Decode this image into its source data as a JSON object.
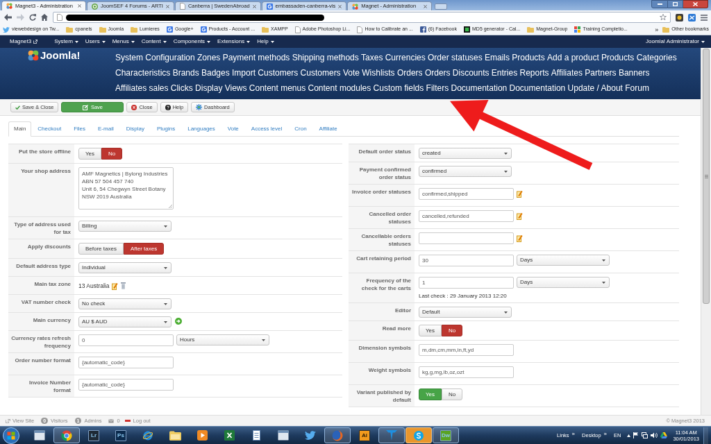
{
  "browser": {
    "tabs": [
      {
        "title": "Magnet3 - Administration",
        "kind": "joomla",
        "selected": true
      },
      {
        "title": "JoomSEF 4 Forums - ARTI",
        "kind": "joomsef",
        "selected": false
      },
      {
        "title": "Canberra | SwedenAbroad",
        "kind": "page",
        "selected": false
      },
      {
        "title": "embassaden-canberra-vis",
        "kind": "google",
        "selected": false
      },
      {
        "title": "Magnet - Administration",
        "kind": "joomla",
        "selected": false
      }
    ],
    "forward": {
      "disabled": true
    },
    "bookmarks": [
      {
        "label": "viewebdesign on Tw...",
        "kind": "twitter"
      },
      {
        "label": "cpanels",
        "kind": "folder"
      },
      {
        "label": "Joomla",
        "kind": "folder"
      },
      {
        "label": "Lumieres",
        "kind": "folder"
      },
      {
        "label": "Google+",
        "kind": "google"
      },
      {
        "label": "Products - Account ...",
        "kind": "google"
      },
      {
        "label": "XAMPP",
        "kind": "folder"
      },
      {
        "label": "Adobe Photoshop Li...",
        "kind": "page"
      },
      {
        "label": "How to Calibrate an ...",
        "kind": "page"
      },
      {
        "label": "(6) Facebook",
        "kind": "facebook"
      },
      {
        "label": "MD5 generator - Cal...",
        "kind": "md5"
      },
      {
        "label": "Magnet-Group",
        "kind": "folder"
      },
      {
        "label": "Training Completio...",
        "kind": "training"
      }
    ],
    "bookmarks_overflow": "»",
    "other_bookmarks": "Other bookmarks"
  },
  "admin_menu": {
    "site": "Magnet3",
    "items": [
      "System",
      "Users",
      "Menus",
      "Content",
      "Components",
      "Extensions",
      "Help"
    ],
    "user": "Joomla! Administrator"
  },
  "header": {
    "logo": "Joomla!",
    "link_rows": [
      [
        "System",
        "Configuration",
        "Zones",
        "Payment methods",
        "Shipping methods",
        "Taxes",
        "Currencies",
        "Order statuses",
        "Emails",
        "Products",
        "Add a product",
        "Products",
        "Categories"
      ],
      [
        "Characteristics",
        "Brands",
        "Badges",
        "Import",
        "Customers",
        "Customers",
        "Vote",
        "Wishlists",
        "Orders",
        "Orders",
        "Discounts",
        "Entries",
        "Reports",
        "Affiliates",
        "Partners",
        "Banners"
      ],
      [
        "Affiliates sales",
        "Clicks",
        "Display",
        "Views",
        "Content menus",
        "Content modules",
        "Custom fields",
        "Filters",
        "Documentation",
        "Documentation",
        "Update / About",
        "Forum"
      ]
    ]
  },
  "toolbar": [
    {
      "label": "Save & Close",
      "kind": "save_close"
    },
    {
      "label": "Save",
      "kind": "save"
    },
    {
      "label": "Close",
      "kind": "close"
    },
    {
      "label": "Help",
      "kind": "help"
    },
    {
      "label": "Dashboard",
      "kind": "dashboard"
    }
  ],
  "tabs": [
    {
      "label": "Main",
      "selected": true
    },
    {
      "label": "Checkout",
      "selected": false
    },
    {
      "label": "Files",
      "selected": false
    },
    {
      "label": "E-mail",
      "selected": false
    },
    {
      "label": "Display",
      "selected": false
    },
    {
      "label": "Plugins",
      "selected": false
    },
    {
      "label": "Languages",
      "selected": false
    },
    {
      "label": "Vote",
      "selected": false
    },
    {
      "label": "Access level",
      "selected": false
    },
    {
      "label": "Cron",
      "selected": false
    },
    {
      "label": "Affiliate",
      "selected": false
    }
  ],
  "left_panel": {
    "rows": [
      {
        "label": "Put the store offline",
        "controls": [
          {
            "kind": "toggle",
            "options": [
              {
                "label": "Yes",
                "selected": false
              },
              {
                "label": "No",
                "selected": true
              }
            ]
          }
        ]
      },
      {
        "label": "Your shop address",
        "controls": [
          {
            "kind": "textarea",
            "value": "AMF Magnetics | Bylong Industries\nABN 57 504 457 740\nUnit 6, 54 Chegwyn Street Botany\nNSW 2019 Australia"
          }
        ]
      },
      {
        "label": "Type of address used for tax",
        "controls": [
          {
            "kind": "select",
            "value": "Billing"
          }
        ]
      },
      {
        "label": "Apply discounts",
        "controls": [
          {
            "kind": "toggle",
            "options": [
              {
                "label": "Before taxes",
                "selected": false
              },
              {
                "label": "After taxes",
                "selected": true
              }
            ]
          }
        ]
      },
      {
        "label": "Default address type",
        "controls": [
          {
            "kind": "select",
            "value": "Individual"
          }
        ]
      },
      {
        "label": "Main tax zone",
        "controls": [
          {
            "kind": "text",
            "value": "13 Australia"
          },
          {
            "kind": "edit_button"
          },
          {
            "kind": "delete_button"
          }
        ]
      },
      {
        "label": "VAT number check",
        "controls": [
          {
            "kind": "select",
            "value": "No check"
          }
        ]
      },
      {
        "label": "Main currency",
        "controls": [
          {
            "kind": "select",
            "value": "AU $ AUD"
          },
          {
            "kind": "refresh_button"
          }
        ]
      },
      {
        "label": "Currency rates refresh frequency",
        "controls": [
          {
            "kind": "input",
            "value": "0"
          },
          {
            "kind": "select",
            "value": "Hours"
          }
        ]
      },
      {
        "label": "Order number format",
        "controls": [
          {
            "kind": "input",
            "value": "{automatic_code}"
          }
        ]
      },
      {
        "label": "Invoice Number format",
        "controls": [
          {
            "kind": "input",
            "value": "{automatic_code}"
          }
        ]
      }
    ]
  },
  "right_panel": {
    "rows": [
      {
        "label": "Default order status",
        "controls": [
          {
            "kind": "select",
            "value": "created"
          }
        ]
      },
      {
        "label": "Payment confirmed order status",
        "controls": [
          {
            "kind": "select",
            "value": "confirmed"
          }
        ]
      },
      {
        "label": "Invoice order statuses",
        "controls": [
          {
            "kind": "input",
            "value": "confirmed,shipped"
          },
          {
            "kind": "edit_button"
          }
        ]
      },
      {
        "label": "Cancelled order statuses",
        "controls": [
          {
            "kind": "input",
            "value": "cancelled,refunded"
          },
          {
            "kind": "edit_button"
          }
        ]
      },
      {
        "label": "Cancellable orders statuses",
        "controls": [
          {
            "kind": "input"
          },
          {
            "kind": "edit_button"
          }
        ]
      },
      {
        "label": "Cart retaining period",
        "controls": [
          {
            "kind": "input",
            "value": "30"
          },
          {
            "kind": "select",
            "value": "Days"
          }
        ]
      },
      {
        "label": "Frequency of the check for the carts",
        "controls": [
          {
            "kind": "input",
            "value": "1"
          },
          {
            "kind": "select",
            "value": "Days"
          }
        ],
        "note": "Last check : 29 January 2013 12:20"
      },
      {
        "label": "Editor",
        "controls": [
          {
            "kind": "select",
            "value": "Default"
          }
        ]
      },
      {
        "label": "Read more",
        "controls": [
          {
            "kind": "toggle",
            "options": [
              {
                "label": "Yes",
                "selected": false
              },
              {
                "label": "No",
                "selected": true
              }
            ]
          }
        ]
      },
      {
        "label": "Dimension symbols",
        "controls": [
          {
            "kind": "input",
            "value": "m,dm,cm,mm,in,ft,yd"
          }
        ]
      },
      {
        "label": "Weight symbols",
        "controls": [
          {
            "kind": "input",
            "value": "kg,g,mg,lb,oz,ozt"
          }
        ]
      },
      {
        "label": "Variant published by default",
        "controls": [
          {
            "kind": "toggle",
            "options": [
              {
                "label": "Yes",
                "selected": true
              },
              {
                "label": "No",
                "selected": false
              }
            ]
          }
        ]
      }
    ]
  },
  "footer": {
    "view_site": "View Site",
    "visitors": {
      "count": "0",
      "label": "Visitors"
    },
    "admins": {
      "count": "1",
      "label": "Admins"
    },
    "messages": "0",
    "logout": "Log out",
    "copyright": "© Magnet3 2013"
  },
  "taskbar": {
    "items": [
      {
        "kind": "window",
        "running": false,
        "attention": false
      },
      {
        "kind": "chrome",
        "running": true,
        "attention": false
      },
      {
        "kind": "tile",
        "label": "Lr",
        "color": "#1e2a36",
        "running": false,
        "attention": false
      },
      {
        "kind": "tile",
        "label": "Ps",
        "color": "#0b2a4d",
        "running": false,
        "attention": false
      },
      {
        "kind": "ie",
        "running": false,
        "attention": false
      },
      {
        "kind": "folder",
        "running": false,
        "attention": false
      },
      {
        "kind": "media",
        "running": false,
        "attention": false
      },
      {
        "kind": "excel",
        "running": false,
        "attention": false
      },
      {
        "kind": "document",
        "running": false,
        "attention": false
      },
      {
        "kind": "window",
        "running": false,
        "attention": false
      },
      {
        "kind": "twitter",
        "running": false,
        "attention": false
      },
      {
        "kind": "firefox",
        "running": true,
        "attention": false
      },
      {
        "kind": "tile",
        "label": "Ai",
        "color": "#f29a1d",
        "running": false,
        "attention": false
      },
      {
        "kind": "telstra",
        "running": true,
        "attention": false
      },
      {
        "kind": "skype",
        "running": true,
        "attention": true
      },
      {
        "kind": "tile",
        "label": "Dw",
        "color": "#5aa324",
        "running": true,
        "attention": false
      }
    ],
    "toolbars": [
      {
        "label": "Links",
        "chevron": "»"
      },
      {
        "label": "Desktop",
        "chevron": "»"
      }
    ],
    "language": "EN",
    "time": "11:04 AM",
    "date": "30/01/2013"
  }
}
